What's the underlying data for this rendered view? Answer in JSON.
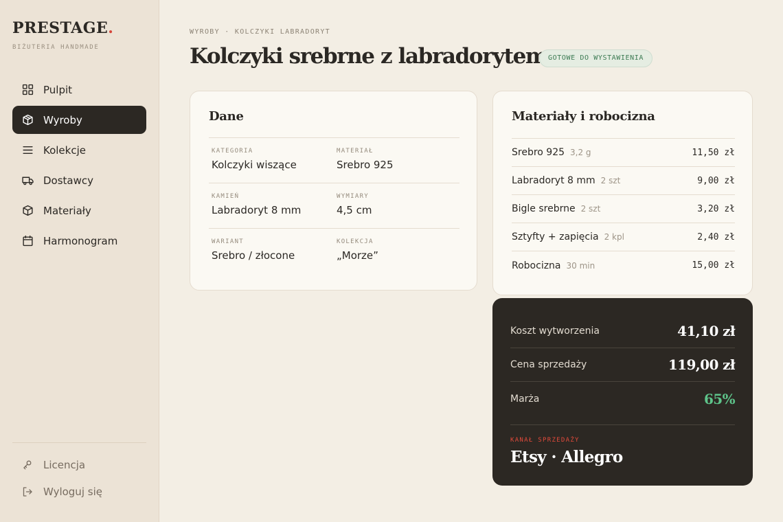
{
  "brand": {
    "name": "PRESTAGE",
    "dot": ".",
    "subtitle": "BIŻUTERIA HANDMADE"
  },
  "nav": {
    "items": [
      {
        "label": "Pulpit",
        "icon": "grid-icon"
      },
      {
        "label": "Wyroby",
        "icon": "package-icon",
        "active": true
      },
      {
        "label": "Kolekcje",
        "icon": "list-icon"
      },
      {
        "label": "Dostawcy",
        "icon": "truck-icon"
      },
      {
        "label": "Materiały",
        "icon": "cube-icon"
      },
      {
        "label": "Harmonogram",
        "icon": "calendar-icon"
      }
    ],
    "bottom": [
      {
        "label": "Licencja",
        "icon": "key-icon"
      },
      {
        "label": "Wyloguj się",
        "icon": "logout-icon"
      }
    ]
  },
  "header": {
    "breadcrumb": "WYROBY · KOLCZYKI LABRADORYT",
    "title": "Kolczyki srebrne z labradorytem",
    "status": "GOTOWE DO WYSTAWIENIA"
  },
  "details": {
    "title": "Dane",
    "rows": [
      [
        {
          "label": "KATEGORIA",
          "value": "Kolczyki wiszące"
        },
        {
          "label": "MATERIAŁ",
          "value": "Srebro 925"
        }
      ],
      [
        {
          "label": "KAMIEŃ",
          "value": "Labradoryt 8 mm"
        },
        {
          "label": "WYMIARY",
          "value": "4,5 cm"
        }
      ],
      [
        {
          "label": "WARIANT",
          "value": "Srebro / złocone"
        },
        {
          "label": "KOLEKCJA",
          "value": "„Morze”"
        }
      ]
    ]
  },
  "materials": {
    "title": "Materiały i robocizna",
    "items": [
      {
        "name": "Srebro 925",
        "qty": "3,2 g",
        "price": "11,50 zł"
      },
      {
        "name": "Labradoryt 8 mm",
        "qty": "2 szt",
        "price": "9,00 zł"
      },
      {
        "name": "Bigle srebrne",
        "qty": "2 szt",
        "price": "3,20 zł"
      },
      {
        "name": "Sztyfty + zapięcia",
        "qty": "2 kpl",
        "price": "2,40 zł"
      },
      {
        "name": "Robocizna",
        "qty": "30 min",
        "price": "15,00 zł"
      }
    ]
  },
  "summary": {
    "cost_label": "Koszt wytworzenia",
    "cost": "41,10 zł",
    "price_label": "Cena sprzedaży",
    "price": "119,00 zł",
    "margin_label": "Marża",
    "margin": "65%",
    "channel_label": "KANAŁ SPRZEDAŻY",
    "channel": "Etsy · Allegro"
  },
  "colors": {
    "accent_dark": "#2c2823",
    "brand_dot": "#d6453a",
    "margin_green": "#5ec48a",
    "badge_green": "#3b7a52"
  }
}
